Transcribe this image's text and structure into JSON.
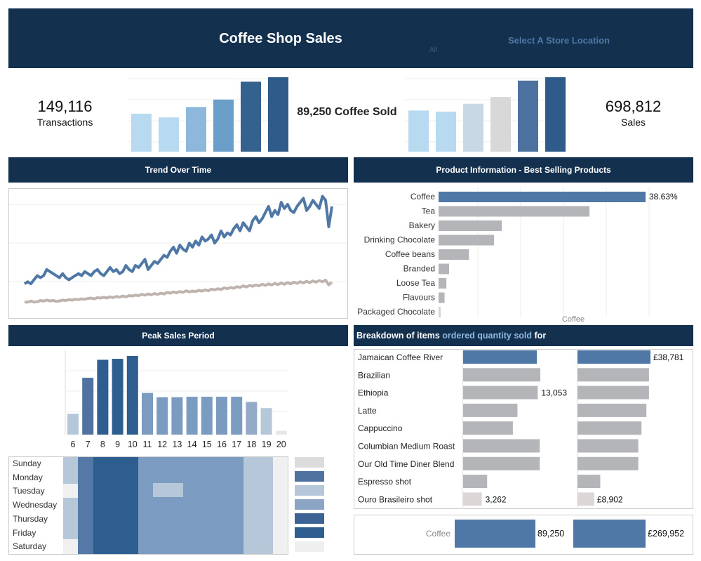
{
  "header": {
    "title": "Coffee Shop Sales",
    "store_label": "Select A Store Location",
    "store_value": "All"
  },
  "kpis": {
    "transactions_value": "149,116",
    "transactions_label": "Transactions",
    "coffee_sold": "89,250 Coffee Sold",
    "sales_value": "698,812",
    "sales_label": "Sales"
  },
  "kpi_bars_left": [
    0.51,
    0.46,
    0.6,
    0.7,
    0.94,
    1.0
  ],
  "kpi_bars_right": [
    0.73,
    0.71,
    0.85,
    0.97,
    1.26,
    1.32
  ],
  "sections": {
    "trend": "Trend Over Time",
    "product": "Product Information - Best Selling Products",
    "peak": "Peak Sales Period",
    "breakdown_pre": "Breakdown of items ",
    "breakdown_mid": "ordered quantity sold",
    "breakdown_post": " for"
  },
  "colors": {
    "navy": "#14304f",
    "blue": "#4f78a6",
    "gray": "#b3b5b8",
    "accent_text": "#8fb8e0"
  },
  "chart_data": [
    {
      "type": "line",
      "title": "Trend Over Time",
      "series": [
        {
          "values": [
            12,
            13,
            12,
            14,
            16,
            15,
            16,
            19,
            18,
            17,
            16,
            15,
            17,
            15,
            14,
            15,
            16,
            17,
            16,
            18,
            17,
            16,
            18,
            19,
            17,
            16,
            18,
            20,
            18,
            19,
            17,
            18,
            21,
            19,
            18,
            21,
            20,
            22,
            24,
            19,
            21,
            23,
            22,
            24,
            26,
            25,
            28,
            30,
            27,
            31,
            29,
            28,
            32,
            30,
            33,
            31,
            35,
            33,
            34,
            36,
            32,
            34,
            38,
            35,
            37,
            36,
            39,
            41,
            38,
            42,
            40,
            38,
            43,
            45,
            42,
            44,
            47,
            50,
            45,
            48,
            46,
            52,
            49,
            51,
            48,
            47,
            50,
            52,
            54,
            48,
            50,
            53,
            51,
            49,
            55,
            53,
            40,
            50
          ]
        },
        {
          "values": [
            3,
            3,
            3.5,
            3,
            3.2,
            3.8,
            3.5,
            4,
            3.6,
            3.8,
            3.4,
            3.6,
            4,
            3.8,
            4.2,
            4,
            4.4,
            4.2,
            4.6,
            4.4,
            4.8,
            5,
            4.6,
            5.2,
            5,
            5.4,
            5,
            5.6,
            5.2,
            5.8,
            5.4,
            6,
            5.6,
            6.2,
            6,
            6.4,
            6.2,
            6.8,
            6.4,
            7,
            6.6,
            7.2,
            6.8,
            7.4,
            7,
            7.8,
            7.4,
            8,
            7.6,
            8.2,
            7.8,
            8.6,
            8,
            8.4,
            8.2,
            8.8,
            8.4,
            9,
            8.6,
            9.4,
            9,
            9.6,
            9.2,
            10,
            9.6,
            10.2,
            9.8,
            10.6,
            10.2,
            11,
            10.4,
            11.2,
            10.8,
            11.4,
            11,
            11.8,
            11.2,
            12,
            11.4,
            12.2,
            11.6,
            12.4,
            11.8,
            12.6,
            12,
            12.8,
            12.2,
            13,
            12.4,
            13.2,
            12.6,
            13.4,
            12.8,
            13.6,
            13,
            13.8,
            11.5,
            12.8
          ]
        }
      ]
    },
    {
      "type": "bar",
      "title": "Product Information - Best Selling Products",
      "categories": [
        "Coffee",
        "Tea",
        "Bakery",
        "Drinking Chocolate",
        "Coffee beans",
        "Branded",
        "Loose Tea",
        "Flavours",
        "Packaged Chocolate"
      ],
      "values": [
        38.63,
        28.17,
        11.79,
        10.36,
        5.67,
        1.96,
        1.46,
        1.12,
        0.31
      ],
      "value_labels": [
        "38.63%",
        "",
        "",
        "",
        "",
        "",
        "",
        "",
        ""
      ],
      "footer": "Coffee"
    },
    {
      "type": "bar",
      "title": "Peak Sales Period",
      "categories": [
        "6",
        "7",
        "8",
        "9",
        "10",
        "11",
        "12",
        "13",
        "14",
        "15",
        "16",
        "17",
        "18",
        "19",
        "20"
      ],
      "values": [
        4.4,
        12.0,
        15.8,
        16.0,
        16.6,
        8.8,
        7.9,
        7.9,
        8.0,
        8.0,
        8.0,
        8.0,
        6.9,
        5.6,
        0.8
      ]
    },
    {
      "type": "heatmap",
      "rows": [
        "Sunday",
        "Monday",
        "Tuesday",
        "Wednesday",
        "Thursday",
        "Friday",
        "Saturday"
      ]
    },
    {
      "type": "bar",
      "title": "Breakdown of items ordered quantity sold for",
      "categories": [
        "Jamaican Coffee River",
        "Brazilian",
        "Ethiopia",
        "Latte",
        "Cappuccino",
        "Columbian Medium Roast",
        "Our Old Time Diner Blend",
        "Espresso shot",
        "Ouro Brasileiro shot"
      ],
      "series": [
        {
          "values": [
            12900,
            13500,
            13053,
            9500,
            8700,
            13400,
            13400,
            4200,
            3262
          ],
          "labels": [
            "",
            "",
            "13,053",
            "",
            "",
            "",
            "",
            "",
            "3,262"
          ]
        },
        {
          "values": [
            38781,
            38000,
            38000,
            36600,
            34000,
            32300,
            32300,
            12100,
            8902
          ],
          "labels": [
            "£38,781",
            "",
            "",
            "",
            "",
            "",
            "",
            "",
            "£8,902"
          ]
        }
      ],
      "totals": {
        "label": "Coffee",
        "quantity": "89,250",
        "revenue": "£269,952"
      }
    }
  ]
}
